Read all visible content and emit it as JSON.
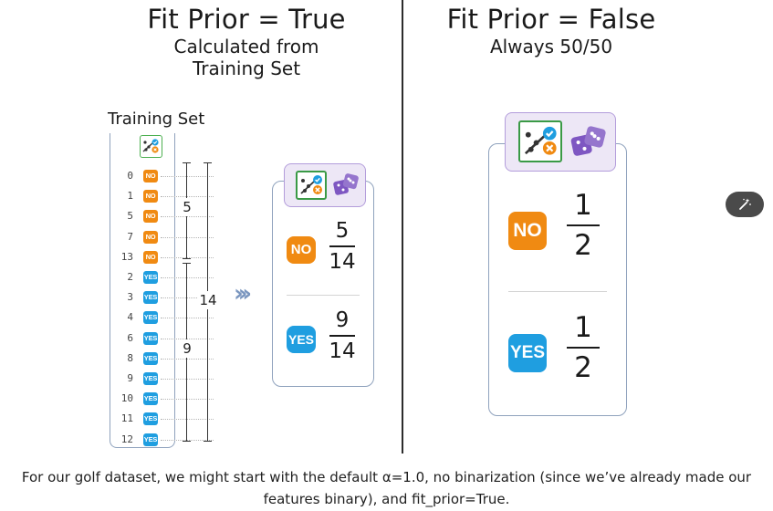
{
  "left": {
    "title": "Fit Prior = True",
    "subtitle_line1": "Calculated from",
    "subtitle_line2": "Training Set",
    "training_set_label": "Training Set",
    "rows": [
      {
        "index": "0",
        "label": "NO"
      },
      {
        "index": "1",
        "label": "NO"
      },
      {
        "index": "5",
        "label": "NO"
      },
      {
        "index": "7",
        "label": "NO"
      },
      {
        "index": "13",
        "label": "NO"
      },
      {
        "index": "2",
        "label": "YES"
      },
      {
        "index": "3",
        "label": "YES"
      },
      {
        "index": "4",
        "label": "YES"
      },
      {
        "index": "6",
        "label": "YES"
      },
      {
        "index": "8",
        "label": "YES"
      },
      {
        "index": "9",
        "label": "YES"
      },
      {
        "index": "10",
        "label": "YES"
      },
      {
        "index": "11",
        "label": "YES"
      },
      {
        "index": "12",
        "label": "YES"
      }
    ],
    "no_count": "5",
    "yes_count": "9",
    "total_count": "14",
    "no_label": "NO",
    "yes_label": "YES",
    "no_prior": {
      "numerator": "5",
      "denominator": "14"
    },
    "yes_prior": {
      "numerator": "9",
      "denominator": "14"
    }
  },
  "right": {
    "title": "Fit Prior = False",
    "subtitle": "Always 50/50",
    "no_label": "NO",
    "yes_label": "YES",
    "no_prior": {
      "numerator": "1",
      "denominator": "2"
    },
    "yes_prior": {
      "numerator": "1",
      "denominator": "2"
    }
  },
  "icons": {
    "classifier": "classifier-check-icon",
    "dice": "dice-icon",
    "arrow": "double-chevron-right-icon",
    "magic": "magic-wand-icon"
  },
  "colors": {
    "no": "#f08a12",
    "yes": "#1f9ee0",
    "panel_border": "#8fa2bd",
    "icon_box": "#ede7f6",
    "dice": "#7e57c2"
  },
  "caption": {
    "line1": "For our golf dataset, we might start with the default α=1.0, no binarization (since we’ve already made our",
    "line2": "features binary), and fit_prior=True."
  }
}
